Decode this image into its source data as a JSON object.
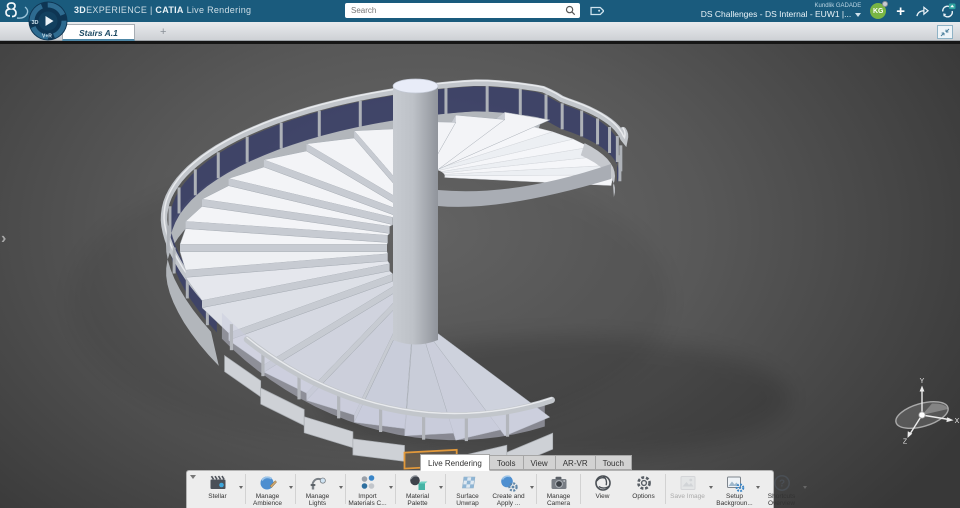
{
  "topbar": {
    "brand": {
      "bold": "3D",
      "rest": "EXPERIENCE",
      "sep": "|",
      "product": "CATIA",
      "module": "Live Rendering"
    },
    "compass": {
      "left": "3D",
      "bottom": "V+R"
    },
    "search": {
      "placeholder": "Search"
    },
    "user": {
      "name": "Kundlik GADADE",
      "initials": "KG"
    },
    "context": "DS Challenges - DS Internal - EUW1 |...",
    "add_label": "+"
  },
  "tabstrip": {
    "tabs": [
      {
        "label": "Stairs A.1",
        "active": true
      }
    ],
    "add_label": "+"
  },
  "viewport": {
    "gizmo": {
      "x": "X",
      "y": "Y",
      "z": "Z"
    }
  },
  "ribbon": {
    "tabs": [
      {
        "label": "Live Rendering",
        "active": true
      },
      {
        "label": "Tools",
        "active": false
      },
      {
        "label": "View",
        "active": false
      },
      {
        "label": "AR-VR",
        "active": false
      },
      {
        "label": "Touch",
        "active": false
      }
    ],
    "tools": [
      {
        "label": "Stellar",
        "icon": "stellar",
        "dropdown": true,
        "disabled": false,
        "sep_after": true
      },
      {
        "label": "Manage Ambience",
        "icon": "ambience",
        "dropdown": true,
        "disabled": false,
        "sep_after": true
      },
      {
        "label": "Manage Lights",
        "icon": "lights",
        "dropdown": true,
        "disabled": false,
        "sep_after": true
      },
      {
        "label": "Import Materials C...",
        "icon": "import-materials",
        "dropdown": true,
        "disabled": false,
        "sep_after": true
      },
      {
        "label": "Material Palette",
        "icon": "material-palette",
        "dropdown": true,
        "disabled": false,
        "sep_after": true
      },
      {
        "label": "Surface Unwrap",
        "icon": "surface-unwrap",
        "dropdown": false,
        "disabled": false,
        "sep_after": false
      },
      {
        "label": "Create and Apply ...",
        "icon": "create-apply",
        "dropdown": true,
        "disabled": false,
        "sep_after": true
      },
      {
        "label": "Manage Camera",
        "icon": "camera",
        "dropdown": false,
        "disabled": false,
        "sep_after": true
      },
      {
        "label": "View",
        "icon": "view",
        "dropdown": false,
        "disabled": false,
        "sep_after": false
      },
      {
        "label": "Options",
        "icon": "options",
        "dropdown": false,
        "disabled": false,
        "sep_after": true
      },
      {
        "label": "Save Image",
        "icon": "save-image",
        "dropdown": true,
        "disabled": true,
        "sep_after": false
      },
      {
        "label": "Setup Backgroun...",
        "icon": "background",
        "dropdown": true,
        "disabled": false,
        "sep_after": false
      },
      {
        "label": "Shortcuts Overview",
        "icon": "help",
        "dropdown": true,
        "disabled": false,
        "sep_after": false
      }
    ]
  },
  "colors": {
    "topbar": "#1a5b7d",
    "accent": "#4e87a6",
    "glass_dark": "#3e4468",
    "glass_light": "#c9ccdd",
    "selection_orange": "#e2993b",
    "avatar_green": "#79b544"
  }
}
